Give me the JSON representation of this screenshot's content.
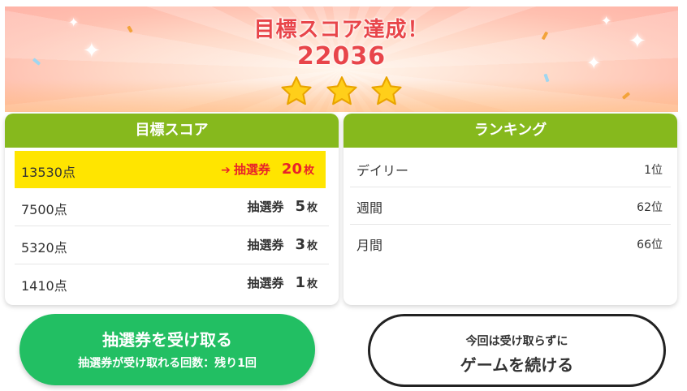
{
  "banner": {
    "title": "目標スコア達成！",
    "score": "22036",
    "stars_earned": 3
  },
  "target_panel": {
    "header": "目標スコア",
    "rows": [
      {
        "points": "13530点",
        "label": "抽選券",
        "count": "20",
        "unit": "枚",
        "highlighted": true
      },
      {
        "points": "7500点",
        "label": "抽選券",
        "count": "5",
        "unit": "枚",
        "highlighted": false
      },
      {
        "points": "5320点",
        "label": "抽選券",
        "count": "3",
        "unit": "枚",
        "highlighted": false
      },
      {
        "points": "1410点",
        "label": "抽選券",
        "count": "1",
        "unit": "枚",
        "highlighted": false
      }
    ]
  },
  "ranking_panel": {
    "header": "ランキング",
    "rows": [
      {
        "name": "デイリー",
        "rank": "1位"
      },
      {
        "name": "週間",
        "rank": "62位"
      },
      {
        "name": "月間",
        "rank": "66位"
      }
    ]
  },
  "receive_button": {
    "line1": "抽選券を受け取る",
    "line2": "抽選券が受け取れる回数：残り1回"
  },
  "continue_button": {
    "line1": "今回は受け取らずに",
    "line2": "ゲームを続ける"
  },
  "colors": {
    "title_red": "#e8454a",
    "header_green": "#86b91d",
    "highlight_yellow": "#ffe500",
    "highlight_text_red": "#e8222a",
    "button_green": "#22bf63"
  }
}
